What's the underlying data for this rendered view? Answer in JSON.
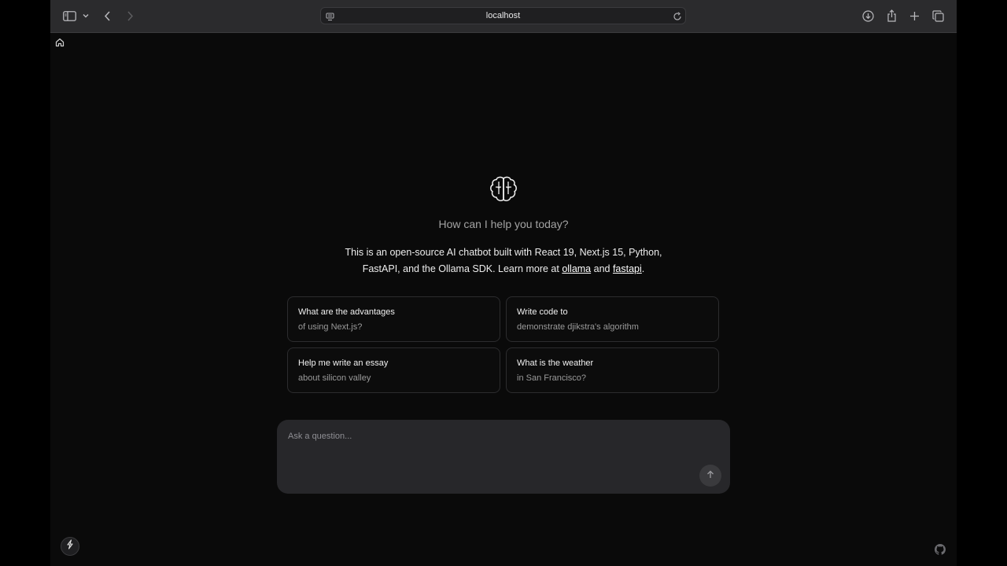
{
  "browser": {
    "url": "localhost",
    "icons": [
      "sidebar-icon",
      "chevron-down-icon",
      "back-icon",
      "forward-icon",
      "page-menu-icon",
      "reload-icon",
      "download-icon",
      "share-icon",
      "new-tab-icon",
      "tab-overview-icon"
    ]
  },
  "main": {
    "greeting": "How can I help you today?",
    "intro_text": "This is an open-source AI chatbot built with React 19, Next.js 15, Python, FastAPI, and the Ollama SDK. Learn more at ",
    "link_ollama": "ollama",
    "and_text": " and ",
    "link_fastapi": "fastapi",
    "end_text": ".",
    "suggestions": [
      {
        "title": "What are the advantages",
        "subtitle": "of using Next.js?"
      },
      {
        "title": "Write code to",
        "subtitle": "demonstrate djikstra's algorithm"
      },
      {
        "title": "Help me write an essay",
        "subtitle": "about silicon valley"
      },
      {
        "title": "What is the weather",
        "subtitle": "in San Francisco?"
      }
    ],
    "input": {
      "value": "",
      "placeholder": "Ask a question..."
    }
  },
  "colors": {
    "background": "#0a0a0a",
    "composer": "#27272a",
    "toolbar": "#2b2b2d"
  }
}
